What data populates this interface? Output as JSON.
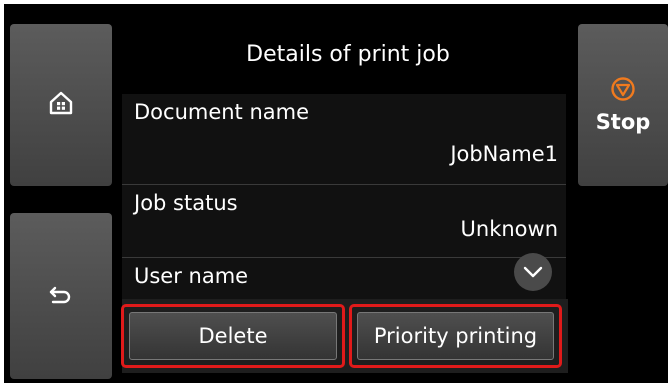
{
  "header": {
    "title": "Details of print job"
  },
  "nav": {
    "home_icon": "home-icon",
    "back_icon": "back-arrow-icon",
    "stop_label": "Stop",
    "stop_icon": "stop-icon"
  },
  "details": {
    "items": [
      {
        "label": "Document name",
        "value": "JobName1"
      },
      {
        "label": "Job status",
        "value": "Unknown"
      },
      {
        "label": "User name",
        "value": ""
      }
    ]
  },
  "actions": {
    "delete_label": "Delete",
    "priority_label": "Priority printing",
    "highlight_color": "#e01a1a"
  }
}
